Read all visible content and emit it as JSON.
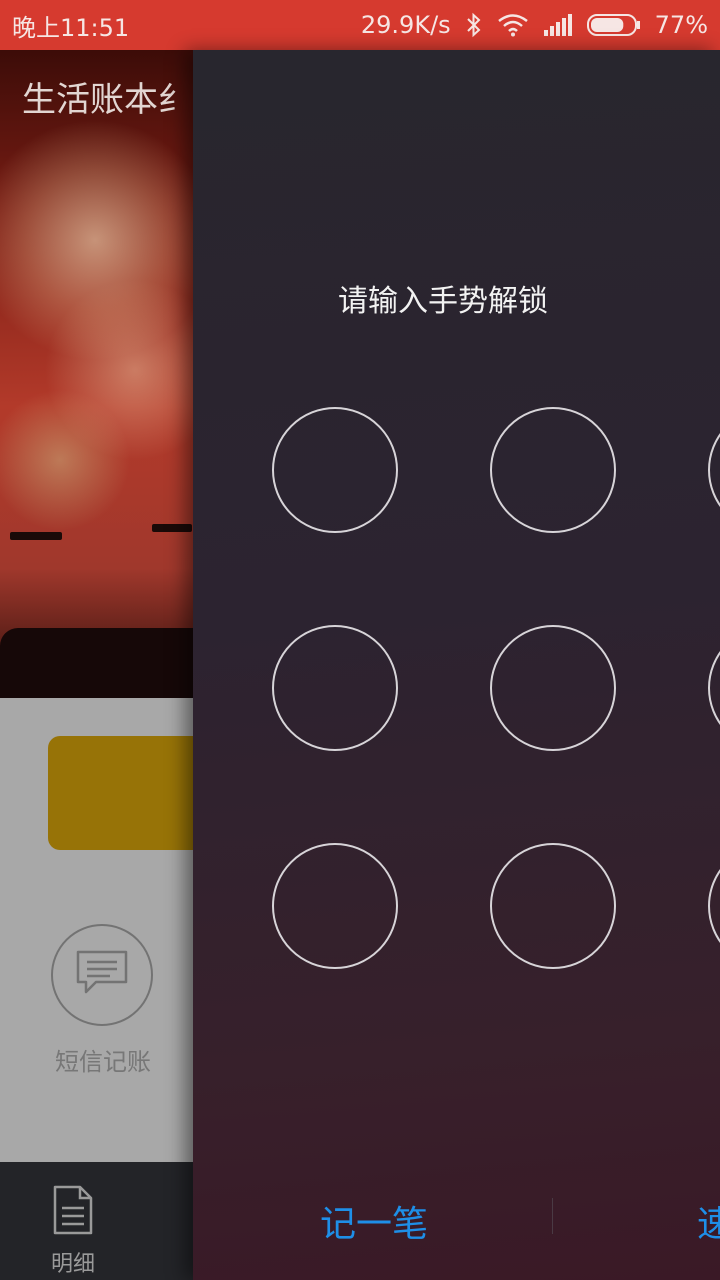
{
  "status_bar": {
    "time": "晚上11:51",
    "net_speed": "29.9K/s",
    "battery": "77%",
    "battery_level": 0.77,
    "icons": [
      "bluetooth-icon",
      "wifi-icon",
      "signal-icon",
      "battery-icon"
    ]
  },
  "background_app": {
    "title": "生活账本纟",
    "sms_label": "短信记账",
    "tab_detail_label": "明细",
    "accent_color": "#977307"
  },
  "lock": {
    "prompt": "请输入手势解锁",
    "dot_count": 9,
    "footer_left": "记一笔",
    "footer_right": "速"
  },
  "colors": {
    "status_bar": "#d63a2f",
    "link": "#1e8fe8",
    "dot_stroke": "#d7d4d8"
  }
}
